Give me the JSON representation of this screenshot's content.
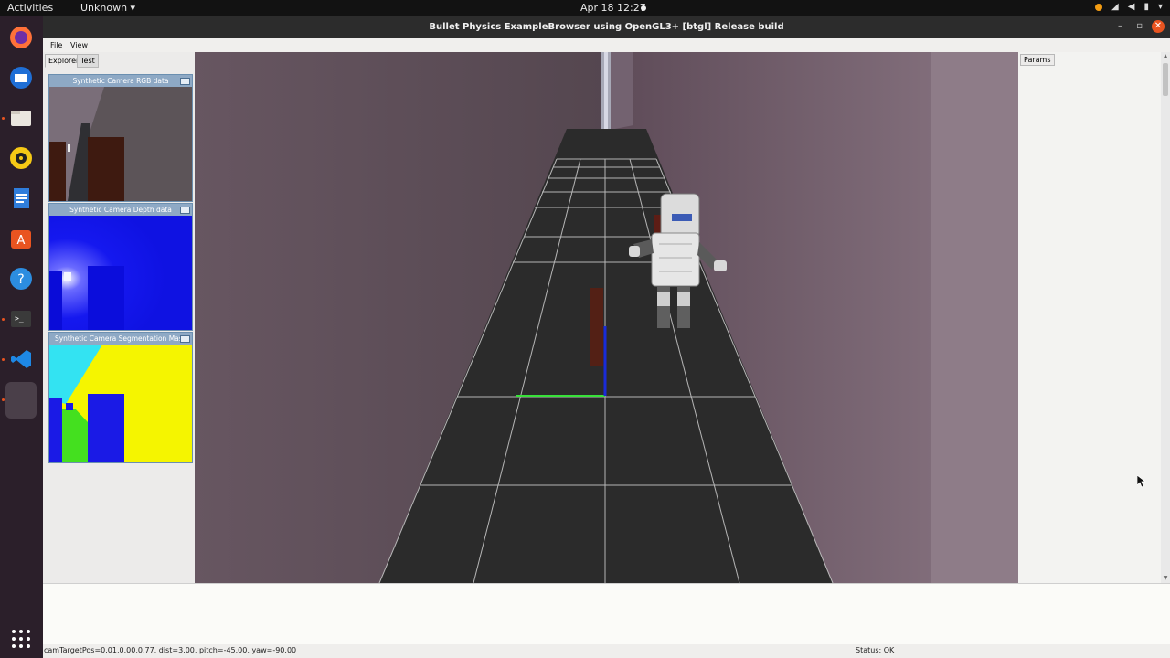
{
  "topbar": {
    "activities": "Activities",
    "app_menu": "Unknown ▾",
    "clock": "Apr 18  12:27"
  },
  "dock": {
    "items": [
      {
        "name": "firefox-icon",
        "glyph": "●"
      },
      {
        "name": "thunderbird-icon",
        "glyph": "✉"
      },
      {
        "name": "files-icon",
        "glyph": "▭"
      },
      {
        "name": "rhythmbox-icon",
        "glyph": "◉"
      },
      {
        "name": "writer-icon",
        "glyph": "▤"
      },
      {
        "name": "software-icon",
        "glyph": "A"
      },
      {
        "name": "help-icon",
        "glyph": "?"
      },
      {
        "name": "terminal-icon",
        "glyph": ">_"
      },
      {
        "name": "vscode-icon",
        "glyph": "⋊"
      },
      {
        "name": "active-app-icon",
        "glyph": ""
      }
    ],
    "apps_grid": "⋮⋮⋮"
  },
  "window": {
    "title": "Bullet Physics ExampleBrowser using OpenGL3+ [btgl] Release build",
    "minimize": "–",
    "restore": "▫",
    "close": "✕"
  },
  "menu": {
    "file": "File",
    "view": "View"
  },
  "left_tabs": {
    "explorer": "Explorer",
    "test": "Test"
  },
  "cameras": {
    "rgb_title": "Synthetic Camera RGB data",
    "depth_title": "Synthetic Camera Depth data",
    "seg_title": "Synthetic Camera Segmentation Mask"
  },
  "params": {
    "tab": "Params"
  },
  "status": {
    "cam": "camTargetPos=0.01,0.00,0.77, dist=3.00, pitch=-45.00, yaw=-90.00",
    "state": "Status: OK"
  },
  "colors": {
    "floor": "#2b2b2b",
    "grid": "#cfcfcf",
    "wall": "#6e5a67",
    "seg_yellow": "#f5f500",
    "seg_cyan": "#33e3f2",
    "depth_blue": "#0d10e8"
  }
}
